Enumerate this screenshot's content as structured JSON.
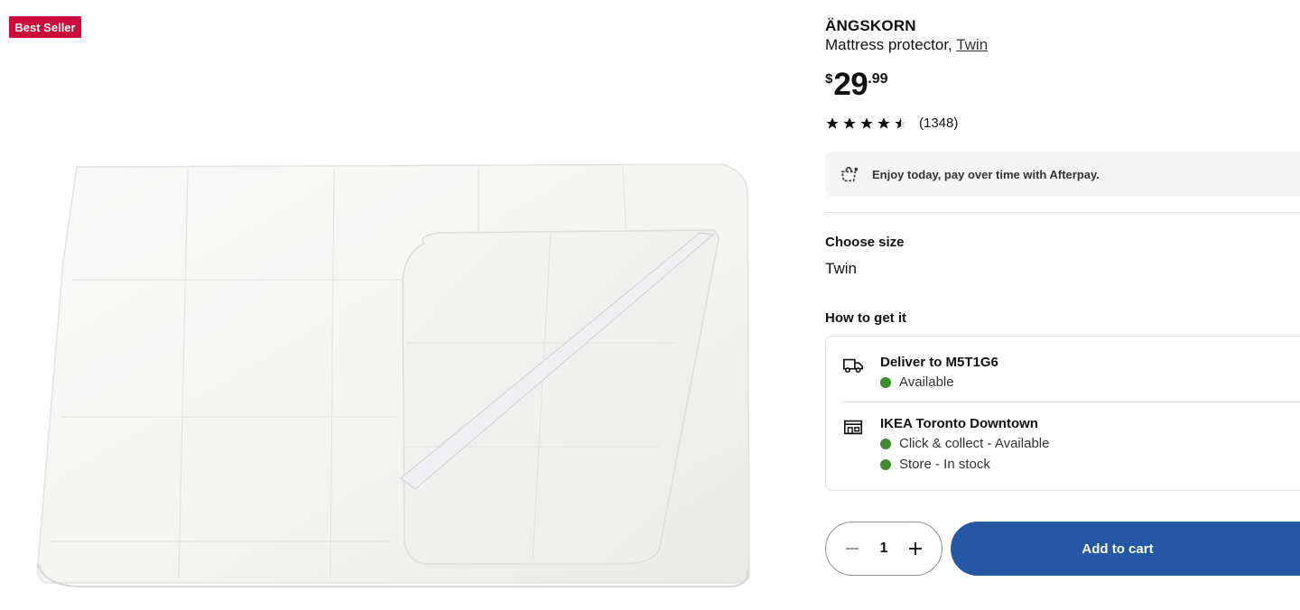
{
  "badge": {
    "label": "Best Seller",
    "color": "#cc0a3b"
  },
  "product": {
    "name": "ÄNGSKORN",
    "description": "Mattress protector,",
    "size_link": "Twin",
    "price": {
      "currency": "$",
      "integer": "29",
      "decimal": ".99"
    },
    "rating": {
      "stars": 4.5,
      "max": 5,
      "review_count": "(1348)"
    }
  },
  "afterpay": {
    "icon": "afterpay-icon",
    "text": "Enjoy today, pay over time with Afterpay."
  },
  "size_section": {
    "label": "Choose size",
    "value": "Twin"
  },
  "get_it": {
    "label": "How to get it",
    "delivery": {
      "icon": "truck-icon",
      "title": "Deliver to M5T1G6",
      "status": "Available"
    },
    "store": {
      "icon": "store-icon",
      "title": "IKEA Toronto Downtown",
      "statuses": [
        "Click & collect - Available",
        "Store - In stock"
      ]
    },
    "status_color": "#3f8c2e"
  },
  "cart": {
    "quantity": "1",
    "add_label": "Add to cart",
    "accent": "#2457a4"
  }
}
